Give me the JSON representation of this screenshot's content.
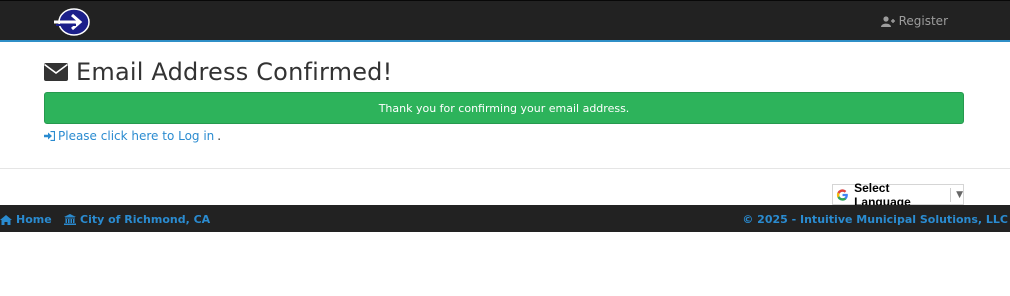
{
  "header": {
    "logo_icon": "circle-arrow-logo",
    "register_label": "Register",
    "register_icon": "user-plus-icon"
  },
  "main": {
    "title_icon": "envelope-icon",
    "title": "Email Address Confirmed!",
    "alert_text": "Thank you for confirming your email address.",
    "login_link": "Please click here to Log in",
    "login_suffix": ".",
    "login_icon": "sign-in-icon"
  },
  "language": {
    "label": "Select Language",
    "icon": "google-g-icon"
  },
  "footer": {
    "home_label": "Home",
    "city_label": "City of Richmond, CA",
    "copyright": "© 2025 - Intuitive Municipal Solutions, LLC"
  },
  "colors": {
    "navbar": "#222222",
    "accent": "#2a8bd0",
    "success": "#2db35b"
  }
}
